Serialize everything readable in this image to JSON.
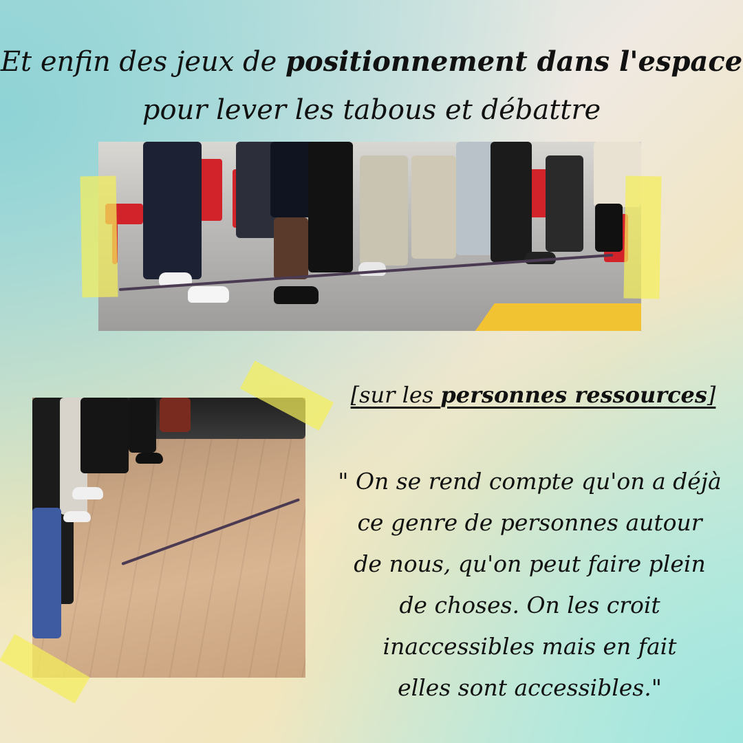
{
  "title": {
    "line1_prefix": "Et enfin des jeux de ",
    "line1_bold": "positionnement dans l'espace",
    "line2": "pour lever les tabous et débattre"
  },
  "subtitle": {
    "open": "[",
    "prefix": "sur les ",
    "bold": "personnes ressources",
    "close": "]"
  },
  "quote": {
    "lines": [
      "\" On se rend compte qu'on a déjà",
      "ce genre de personnes autour",
      "de nous, qu'on peut faire plein",
      "de choses.  On les croit",
      "inaccessibles mais en fait",
      "elles sont accessibles.\""
    ]
  },
  "colors": {
    "tape": "#f4ee5a",
    "chair": "#d2232b",
    "text": "#111111"
  }
}
